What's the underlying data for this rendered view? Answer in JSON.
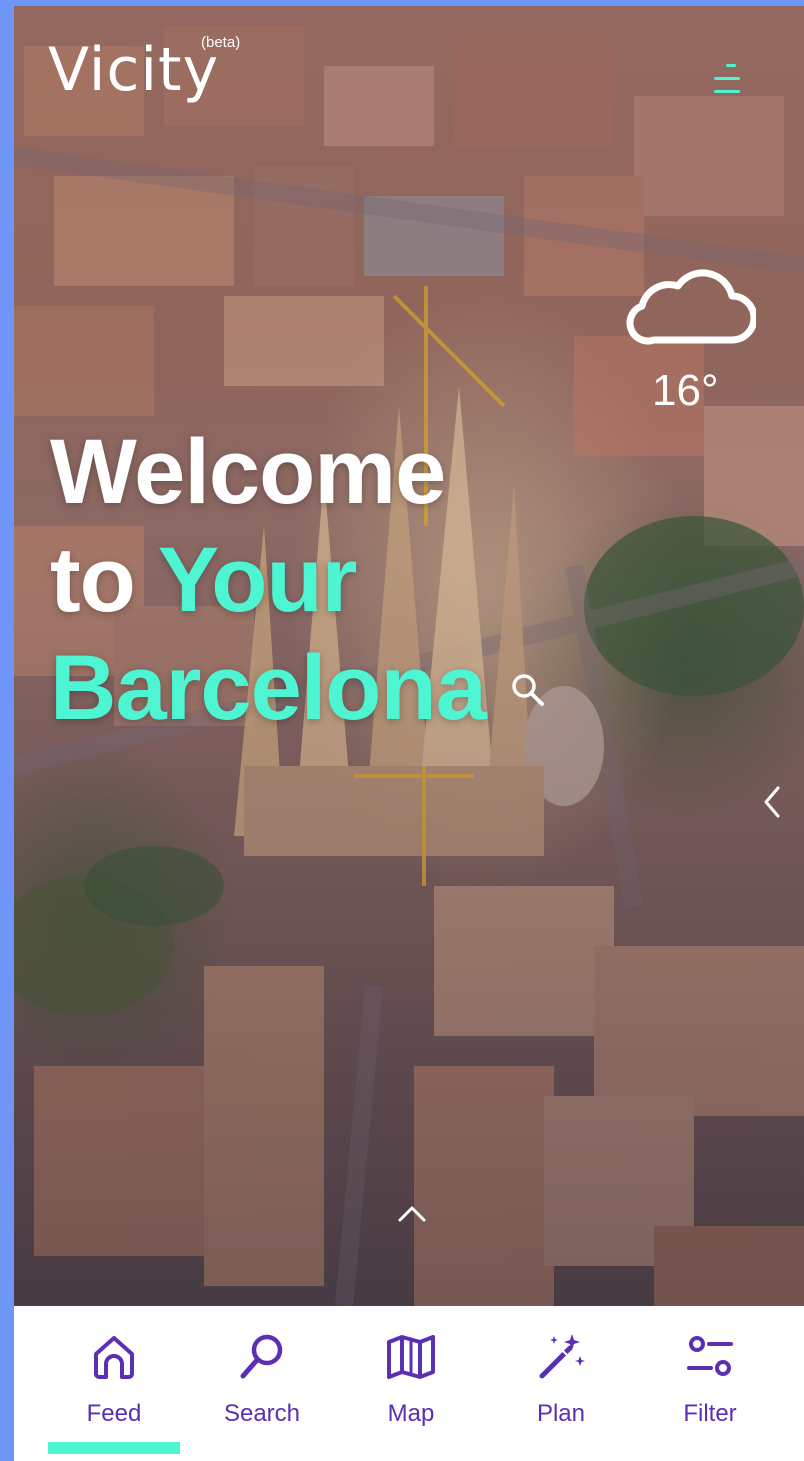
{
  "header": {
    "app_name": "Vicity",
    "badge": "(beta)",
    "menu_icon": "hamburger-menu-icon"
  },
  "weather": {
    "icon": "cloud-icon",
    "temperature": "16°"
  },
  "hero": {
    "line1": "Welcome",
    "line2_prefix": "to ",
    "line2_accent": "Your",
    "line3": "Barcelona",
    "search_icon": "search-icon",
    "side_arrow_icon": "chevron-left-icon",
    "up_arrow_icon": "chevron-up-icon"
  },
  "nav": {
    "active_index": 0,
    "items": [
      {
        "label": "Feed",
        "icon": "home-icon"
      },
      {
        "label": "Search",
        "icon": "search-icon"
      },
      {
        "label": "Map",
        "icon": "map-icon"
      },
      {
        "label": "Plan",
        "icon": "magic-wand-icon"
      },
      {
        "label": "Filter",
        "icon": "filter-icon"
      }
    ]
  },
  "colors": {
    "accent": "#4df5d3",
    "nav_text": "#5b2fb3",
    "frame_background": "#6f96f7"
  }
}
